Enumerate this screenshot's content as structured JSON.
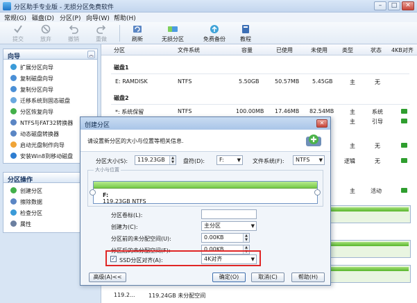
{
  "window": {
    "title": "分区助手专业版 - 无损分区免费软件",
    "minimize": "–",
    "restore": "□",
    "close": "✕"
  },
  "menu": [
    "常规(G)",
    "磁盘(D)",
    "分区(P)",
    "向导(W)",
    "帮助(H)"
  ],
  "toolbar": {
    "commit": "提交",
    "discard": "放弃",
    "undo": "撤销",
    "redo": "重做",
    "refresh": "刷新",
    "lossless_partition": "无损分区",
    "free_backup": "免费备份",
    "tutorial": "教程"
  },
  "sidebar": {
    "wizard_title": "向导",
    "wizard_items": [
      "扩展分区向导",
      "复制磁盘向导",
      "复制分区向导",
      "迁移系统到固态磁盘",
      "分区恢复向导",
      "NTFS与FAT32转换器",
      "动态磁盘转换器",
      "启动光盘制作向导",
      "安装Win8到移动磁盘"
    ],
    "ops_title": "分区操作",
    "ops_items": [
      "创建分区",
      "擦除数据",
      "检查分区",
      "属性"
    ]
  },
  "list": {
    "columns": [
      "分区",
      "文件系统",
      "容量",
      "已使用",
      "未使用",
      "类型",
      "状态",
      "4KB对齐"
    ],
    "disk1": {
      "title": "磁盘1",
      "rows": [
        {
          "name": "E: RAMDISK",
          "fs": "NTFS",
          "capacity": "5.50GB",
          "used": "50.57MB",
          "free": "5.45GB",
          "type": "主",
          "status": "无"
        }
      ]
    },
    "disk2": {
      "title": "磁盘2",
      "rows": [
        {
          "name": "*: 系统保留",
          "fs": "NTFS",
          "capacity": "100.00MB",
          "used": "17.46MB",
          "free": "82.54MB",
          "type": "主",
          "status": "系统"
        },
        {
          "type": "主",
          "status": "引导"
        },
        {
          "type": "主",
          "status": "无"
        },
        {
          "type": "逻辑",
          "status": "无"
        },
        {
          "type": "主",
          "status": "活动"
        }
      ]
    },
    "bottom_size": "119.2...",
    "bottom_desc": "119.24GB 未分配空间"
  },
  "dialog": {
    "title": "创建分区",
    "close": "✕",
    "description": "请设置新分区的大小与位置等相关信息.",
    "size_label": "分区大小(S):",
    "size_value": "119.23GB",
    "drive_label": "盘符(D):",
    "drive_value": "F:",
    "fs_label": "文件系统(F):",
    "fs_value": "NTFS",
    "group_title": "大小与位置",
    "partition_name": "F:",
    "partition_info": "119.23GB NTFS",
    "volume_label": "分区卷标(L):",
    "volume_value": "",
    "create_as_label": "创建为(C):",
    "create_as_value": "主分区",
    "before_label": "分区前的未分配空间(U):",
    "before_value": "0.00KB",
    "after_label": "分区后的未分配空间(F):",
    "after_value": "0.00KB",
    "ssd_label": "SSD分区对齐(A):",
    "ssd_checked": "✓",
    "ssd_value": "4K对齐",
    "advanced": "高级(A)<<",
    "ok": "确定(O)",
    "cancel": "取消(C)",
    "help": "帮助(H)"
  },
  "colors": {
    "accent": "#2f6fbf",
    "partition_green": "#76c948",
    "highlight_red": "#e02525",
    "flag_green": "#2f9e2f"
  }
}
